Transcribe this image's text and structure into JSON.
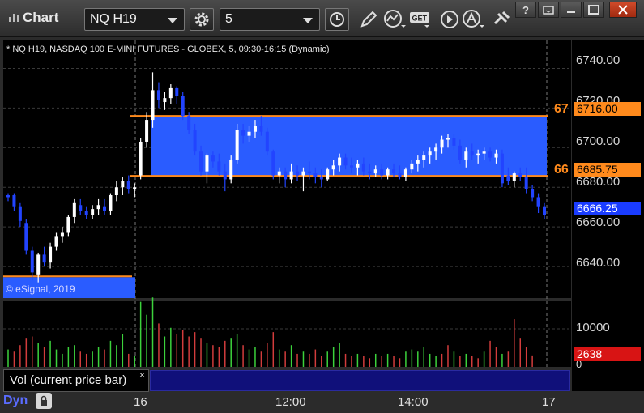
{
  "window": {
    "title": "Chart"
  },
  "toolbar": {
    "symbol": "NQ H19",
    "interval": "5",
    "icons": [
      "settings-gear-icon",
      "clock-icon",
      "pencil-icon",
      "indicator-icon",
      "get-icon",
      "play-icon",
      "alert-icon",
      "tools-icon"
    ],
    "window_controls": [
      "help-icon",
      "restore-icon",
      "maximize-icon",
      "close-icon"
    ]
  },
  "chart": {
    "header": "* NQ H19, NASDAQ 100 E-MINI FUTURES - GLOBEX, 5, 09:30-16:15 (Dynamic)",
    "copyright": "© eSignal, 2019",
    "price_axis": [
      "6740.00",
      "6720.00",
      "6700.00",
      "6680.00",
      "6660.00",
      "6640.00"
    ],
    "time_axis": [
      "16",
      "12:00",
      "14:00",
      "17"
    ],
    "upper_line": {
      "label": "67",
      "price": "6716.00",
      "color": "#ff8a1c"
    },
    "lower_line": {
      "label": "66",
      "price": "6685.75",
      "color": "#ff8a1c"
    },
    "last_price": "6666.25",
    "volume_axis": [
      "10000",
      "0"
    ],
    "last_volume": "2638",
    "volume_panel_label": "Vol (current price bar)",
    "close_glyph": "×",
    "mode_label": "Dyn"
  },
  "colors": {
    "background": "#000000",
    "band": "#2a5cff",
    "level_line": "#ff8a1c",
    "up_candle": "#ffffff",
    "down_candle": "#2244ff",
    "volume_up": "#3cd23c",
    "volume_down": "#d23c3c",
    "last_price_tag": "#1a3cff",
    "last_volume_tag": "#d81414"
  },
  "chart_data": {
    "type": "candlestick",
    "y_range": [
      6620,
      6750
    ],
    "sessions": [
      "prior",
      "16",
      "17"
    ],
    "candles": [
      {
        "o": 6676,
        "h": 6677,
        "l": 6673,
        "c": 6675
      },
      {
        "o": 6676,
        "h": 6677,
        "l": 6668,
        "c": 6670
      },
      {
        "o": 6670,
        "h": 6672,
        "l": 6660,
        "c": 6663
      },
      {
        "o": 6662,
        "h": 6664,
        "l": 6646,
        "c": 6648
      },
      {
        "o": 6648,
        "h": 6650,
        "l": 6633,
        "c": 6637
      },
      {
        "o": 6636,
        "h": 6647,
        "l": 6632,
        "c": 6646
      },
      {
        "o": 6646,
        "h": 6650,
        "l": 6640,
        "c": 6642
      },
      {
        "o": 6642,
        "h": 6652,
        "l": 6639,
        "c": 6650
      },
      {
        "o": 6650,
        "h": 6657,
        "l": 6648,
        "c": 6655
      },
      {
        "o": 6655,
        "h": 6660,
        "l": 6652,
        "c": 6657
      },
      {
        "o": 6657,
        "h": 6666,
        "l": 6655,
        "c": 6665
      },
      {
        "o": 6665,
        "h": 6674,
        "l": 6662,
        "c": 6672
      },
      {
        "o": 6671,
        "h": 6674,
        "l": 6666,
        "c": 6668
      },
      {
        "o": 6668,
        "h": 6670,
        "l": 6664,
        "c": 6666
      },
      {
        "o": 6666,
        "h": 6671,
        "l": 6664,
        "c": 6669
      },
      {
        "o": 6669,
        "h": 6674,
        "l": 6666,
        "c": 6671
      },
      {
        "o": 6670,
        "h": 6674,
        "l": 6666,
        "c": 6668
      },
      {
        "o": 6668,
        "h": 6677,
        "l": 6666,
        "c": 6676
      },
      {
        "o": 6676,
        "h": 6683,
        "l": 6673,
        "c": 6680
      },
      {
        "o": 6680,
        "h": 6685,
        "l": 6676,
        "c": 6683
      },
      {
        "o": 6683,
        "h": 6686,
        "l": 6677,
        "c": 6679
      },
      {
        "o": 6679,
        "h": 6682,
        "l": 6675,
        "c": 6680
      },
      {
        "o": 6686,
        "h": 6705,
        "l": 6684,
        "c": 6703
      },
      {
        "o": 6703,
        "h": 6718,
        "l": 6700,
        "c": 6714
      },
      {
        "o": 6714,
        "h": 6738,
        "l": 6710,
        "c": 6729
      },
      {
        "o": 6729,
        "h": 6733,
        "l": 6720,
        "c": 6724
      },
      {
        "o": 6723,
        "h": 6728,
        "l": 6719,
        "c": 6725
      },
      {
        "o": 6725,
        "h": 6732,
        "l": 6722,
        "c": 6730
      },
      {
        "o": 6730,
        "h": 6731,
        "l": 6722,
        "c": 6726
      },
      {
        "o": 6726,
        "h": 6728,
        "l": 6714,
        "c": 6716
      },
      {
        "o": 6716,
        "h": 6718,
        "l": 6707,
        "c": 6709
      },
      {
        "o": 6709,
        "h": 6712,
        "l": 6696,
        "c": 6698
      },
      {
        "o": 6698,
        "h": 6701,
        "l": 6686,
        "c": 6688
      },
      {
        "o": 6688,
        "h": 6697,
        "l": 6682,
        "c": 6696
      },
      {
        "o": 6696,
        "h": 6698,
        "l": 6690,
        "c": 6693
      },
      {
        "o": 6693,
        "h": 6697,
        "l": 6686,
        "c": 6688
      },
      {
        "o": 6688,
        "h": 6692,
        "l": 6678,
        "c": 6684
      },
      {
        "o": 6684,
        "h": 6696,
        "l": 6682,
        "c": 6694
      },
      {
        "o": 6694,
        "h": 6712,
        "l": 6692,
        "c": 6709
      },
      {
        "o": 6709,
        "h": 6712,
        "l": 6702,
        "c": 6706
      },
      {
        "o": 6706,
        "h": 6711,
        "l": 6703,
        "c": 6708
      },
      {
        "o": 6708,
        "h": 6714,
        "l": 6705,
        "c": 6711
      },
      {
        "o": 6711,
        "h": 6716,
        "l": 6706,
        "c": 6708
      },
      {
        "o": 6708,
        "h": 6710,
        "l": 6696,
        "c": 6698
      },
      {
        "o": 6698,
        "h": 6699,
        "l": 6684,
        "c": 6686
      },
      {
        "o": 6686,
        "h": 6690,
        "l": 6682,
        "c": 6688
      },
      {
        "o": 6688,
        "h": 6690,
        "l": 6680,
        "c": 6684
      },
      {
        "o": 6684,
        "h": 6692,
        "l": 6682,
        "c": 6688
      },
      {
        "o": 6688,
        "h": 6691,
        "l": 6683,
        "c": 6686
      },
      {
        "o": 6686,
        "h": 6690,
        "l": 6678,
        "c": 6688
      },
      {
        "o": 6688,
        "h": 6693,
        "l": 6684,
        "c": 6687
      },
      {
        "o": 6687,
        "h": 6690,
        "l": 6682,
        "c": 6685
      },
      {
        "o": 6685,
        "h": 6689,
        "l": 6680,
        "c": 6684
      },
      {
        "o": 6684,
        "h": 6690,
        "l": 6683,
        "c": 6689
      },
      {
        "o": 6689,
        "h": 6694,
        "l": 6686,
        "c": 6691
      },
      {
        "o": 6691,
        "h": 6697,
        "l": 6688,
        "c": 6695
      },
      {
        "o": 6695,
        "h": 6697,
        "l": 6689,
        "c": 6691
      },
      {
        "o": 6691,
        "h": 6695,
        "l": 6687,
        "c": 6690
      },
      {
        "o": 6690,
        "h": 6694,
        "l": 6686,
        "c": 6692
      },
      {
        "o": 6692,
        "h": 6695,
        "l": 6686,
        "c": 6688
      },
      {
        "o": 6688,
        "h": 6692,
        "l": 6684,
        "c": 6687
      },
      {
        "o": 6687,
        "h": 6691,
        "l": 6685,
        "c": 6689
      },
      {
        "o": 6689,
        "h": 6692,
        "l": 6684,
        "c": 6686
      },
      {
        "o": 6686,
        "h": 6690,
        "l": 6684,
        "c": 6689
      },
      {
        "o": 6689,
        "h": 6692,
        "l": 6685,
        "c": 6687
      },
      {
        "o": 6687,
        "h": 6691,
        "l": 6684,
        "c": 6685
      },
      {
        "o": 6685,
        "h": 6690,
        "l": 6683,
        "c": 6689
      },
      {
        "o": 6689,
        "h": 6694,
        "l": 6687,
        "c": 6692
      },
      {
        "o": 6692,
        "h": 6696,
        "l": 6688,
        "c": 6694
      },
      {
        "o": 6694,
        "h": 6698,
        "l": 6690,
        "c": 6696
      },
      {
        "o": 6696,
        "h": 6700,
        "l": 6692,
        "c": 6698
      },
      {
        "o": 6698,
        "h": 6702,
        "l": 6694,
        "c": 6700
      },
      {
        "o": 6700,
        "h": 6706,
        "l": 6697,
        "c": 6704
      },
      {
        "o": 6704,
        "h": 6707,
        "l": 6700,
        "c": 6705
      },
      {
        "o": 6705,
        "h": 6707,
        "l": 6699,
        "c": 6701
      },
      {
        "o": 6701,
        "h": 6704,
        "l": 6692,
        "c": 6694
      },
      {
        "o": 6694,
        "h": 6700,
        "l": 6690,
        "c": 6698
      },
      {
        "o": 6698,
        "h": 6702,
        "l": 6694,
        "c": 6696
      },
      {
        "o": 6696,
        "h": 6699,
        "l": 6692,
        "c": 6697
      },
      {
        "o": 6697,
        "h": 6700,
        "l": 6694,
        "c": 6698
      },
      {
        "o": 6698,
        "h": 6700,
        "l": 6693,
        "c": 6695
      },
      {
        "o": 6695,
        "h": 6699,
        "l": 6692,
        "c": 6697
      },
      {
        "o": 6697,
        "h": 6699,
        "l": 6680,
        "c": 6682
      },
      {
        "o": 6686,
        "h": 6690,
        "l": 6681,
        "c": 6683
      },
      {
        "o": 6683,
        "h": 6688,
        "l": 6680,
        "c": 6687
      },
      {
        "o": 6687,
        "h": 6690,
        "l": 6683,
        "c": 6685
      },
      {
        "o": 6685,
        "h": 6690,
        "l": 6677,
        "c": 6679
      },
      {
        "o": 6679,
        "h": 6681,
        "l": 6673,
        "c": 6675
      },
      {
        "o": 6675,
        "h": 6677,
        "l": 6667,
        "c": 6670
      },
      {
        "o": 6670,
        "h": 6672,
        "l": 6664,
        "c": 6666
      }
    ],
    "volume": [
      {
        "v": 4000,
        "up": true
      },
      {
        "v": 3500,
        "up": false
      },
      {
        "v": 5000,
        "up": false
      },
      {
        "v": 6500,
        "up": false
      },
      {
        "v": 7000,
        "up": false
      },
      {
        "v": 5500,
        "up": true
      },
      {
        "v": 4500,
        "up": false
      },
      {
        "v": 6000,
        "up": true
      },
      {
        "v": 4000,
        "up": true
      },
      {
        "v": 3000,
        "up": true
      },
      {
        "v": 4500,
        "up": true
      },
      {
        "v": 5000,
        "up": true
      },
      {
        "v": 3500,
        "up": false
      },
      {
        "v": 3000,
        "up": false
      },
      {
        "v": 3500,
        "up": true
      },
      {
        "v": 4500,
        "up": true
      },
      {
        "v": 4000,
        "up": false
      },
      {
        "v": 6000,
        "up": true
      },
      {
        "v": 5000,
        "up": true
      },
      {
        "v": 7500,
        "up": true
      },
      {
        "v": 3000,
        "up": false
      },
      {
        "v": 2500,
        "up": true
      },
      {
        "v": 15000,
        "up": true
      },
      {
        "v": 12000,
        "up": true
      },
      {
        "v": 16000,
        "up": true
      },
      {
        "v": 10000,
        "up": false
      },
      {
        "v": 7000,
        "up": true
      },
      {
        "v": 9000,
        "up": true
      },
      {
        "v": 7500,
        "up": false
      },
      {
        "v": 8500,
        "up": false
      },
      {
        "v": 7000,
        "up": false
      },
      {
        "v": 8000,
        "up": false
      },
      {
        "v": 6500,
        "up": false
      },
      {
        "v": 5500,
        "up": true
      },
      {
        "v": 5000,
        "up": false
      },
      {
        "v": 4500,
        "up": false
      },
      {
        "v": 6000,
        "up": false
      },
      {
        "v": 6500,
        "up": true
      },
      {
        "v": 7500,
        "up": true
      },
      {
        "v": 5000,
        "up": false
      },
      {
        "v": 4000,
        "up": true
      },
      {
        "v": 4500,
        "up": true
      },
      {
        "v": 3500,
        "up": false
      },
      {
        "v": 5500,
        "up": false
      },
      {
        "v": 8000,
        "up": false
      },
      {
        "v": 4000,
        "up": true
      },
      {
        "v": 3500,
        "up": false
      },
      {
        "v": 5000,
        "up": true
      },
      {
        "v": 3000,
        "up": false
      },
      {
        "v": 3500,
        "up": true
      },
      {
        "v": 3000,
        "up": false
      },
      {
        "v": 4000,
        "up": false
      },
      {
        "v": 2500,
        "up": false
      },
      {
        "v": 3500,
        "up": true
      },
      {
        "v": 4500,
        "up": true
      },
      {
        "v": 5500,
        "up": true
      },
      {
        "v": 3000,
        "up": false
      },
      {
        "v": 2500,
        "up": false
      },
      {
        "v": 3000,
        "up": true
      },
      {
        "v": 2500,
        "up": false
      },
      {
        "v": 2000,
        "up": false
      },
      {
        "v": 3000,
        "up": true
      },
      {
        "v": 2500,
        "up": false
      },
      {
        "v": 3000,
        "up": true
      },
      {
        "v": 2500,
        "up": false
      },
      {
        "v": 2000,
        "up": false
      },
      {
        "v": 3500,
        "up": true
      },
      {
        "v": 4000,
        "up": true
      },
      {
        "v": 3500,
        "up": true
      },
      {
        "v": 4500,
        "up": true
      },
      {
        "v": 3000,
        "up": true
      },
      {
        "v": 2500,
        "up": true
      },
      {
        "v": 3000,
        "up": false
      },
      {
        "v": 5000,
        "up": false
      },
      {
        "v": 3500,
        "up": true
      },
      {
        "v": 2500,
        "up": false
      },
      {
        "v": 3000,
        "up": true
      },
      {
        "v": 2500,
        "up": false
      },
      {
        "v": 2000,
        "up": false
      },
      {
        "v": 3500,
        "up": true
      },
      {
        "v": 6000,
        "up": false
      },
      {
        "v": 4500,
        "up": false
      },
      {
        "v": 3000,
        "up": true
      },
      {
        "v": 3500,
        "up": false
      },
      {
        "v": 11000,
        "up": false
      },
      {
        "v": 6500,
        "up": false
      },
      {
        "v": 4500,
        "up": false
      },
      {
        "v": 2638,
        "up": false
      }
    ],
    "volume_range": [
      0,
      14000
    ],
    "band": {
      "top": 6716.0,
      "bottom": 6685.75
    },
    "prior_line": 6635
  }
}
